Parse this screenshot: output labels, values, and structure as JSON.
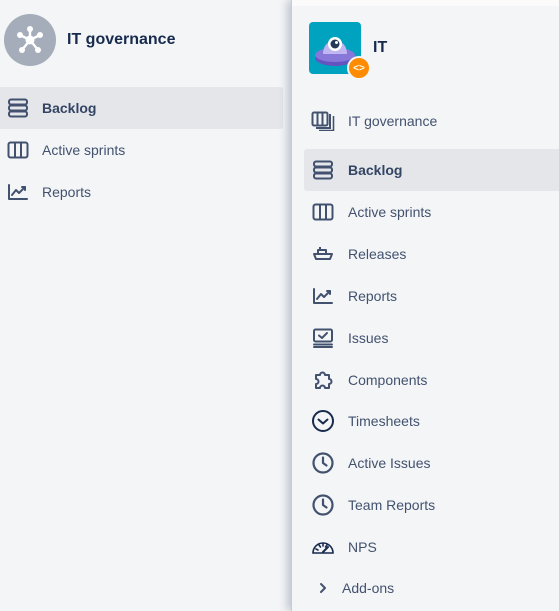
{
  "left_panel": {
    "project_title": "IT governance",
    "project_icon": "network-hub-icon",
    "items": [
      {
        "label": "Backlog",
        "icon": "backlog-icon",
        "active": true
      },
      {
        "label": "Active sprints",
        "icon": "board-columns-icon",
        "active": false
      },
      {
        "label": "Reports",
        "icon": "reports-chart-icon",
        "active": false
      }
    ]
  },
  "right_panel": {
    "project_title": "IT",
    "project_logo": "ufo-robot-icon",
    "badge_glyph": "<>",
    "items": [
      {
        "label": "IT governance",
        "icon": "board-stack-icon",
        "active": false
      },
      {
        "label": "Backlog",
        "icon": "backlog-icon",
        "active": true
      },
      {
        "label": "Active sprints",
        "icon": "board-columns-icon",
        "active": false
      },
      {
        "label": "Releases",
        "icon": "ship-icon",
        "active": false
      },
      {
        "label": "Reports",
        "icon": "reports-chart-icon",
        "active": false
      },
      {
        "label": "Issues",
        "icon": "issues-icon",
        "active": false
      },
      {
        "label": "Components",
        "icon": "puzzle-icon",
        "active": false
      },
      {
        "label": "Timesheets",
        "icon": "timesheet-clock-icon",
        "active": false
      },
      {
        "label": "Active Issues",
        "icon": "clock-icon",
        "active": false
      },
      {
        "label": "Team Reports",
        "icon": "clock-icon",
        "active": false
      },
      {
        "label": "NPS",
        "icon": "gauge-icon",
        "active": false
      },
      {
        "label": "Add-ons",
        "icon": "chevron-right-icon",
        "active": false
      }
    ]
  },
  "colors": {
    "sidebar_bg": "#f4f5f7",
    "active_bg": "#e4e6ea",
    "text": "#42526e",
    "title": "#172b4d",
    "project_logo_bg": "#00a3bf",
    "badge_bg": "#ff8b00",
    "avatar_bg": "#a5adba"
  }
}
